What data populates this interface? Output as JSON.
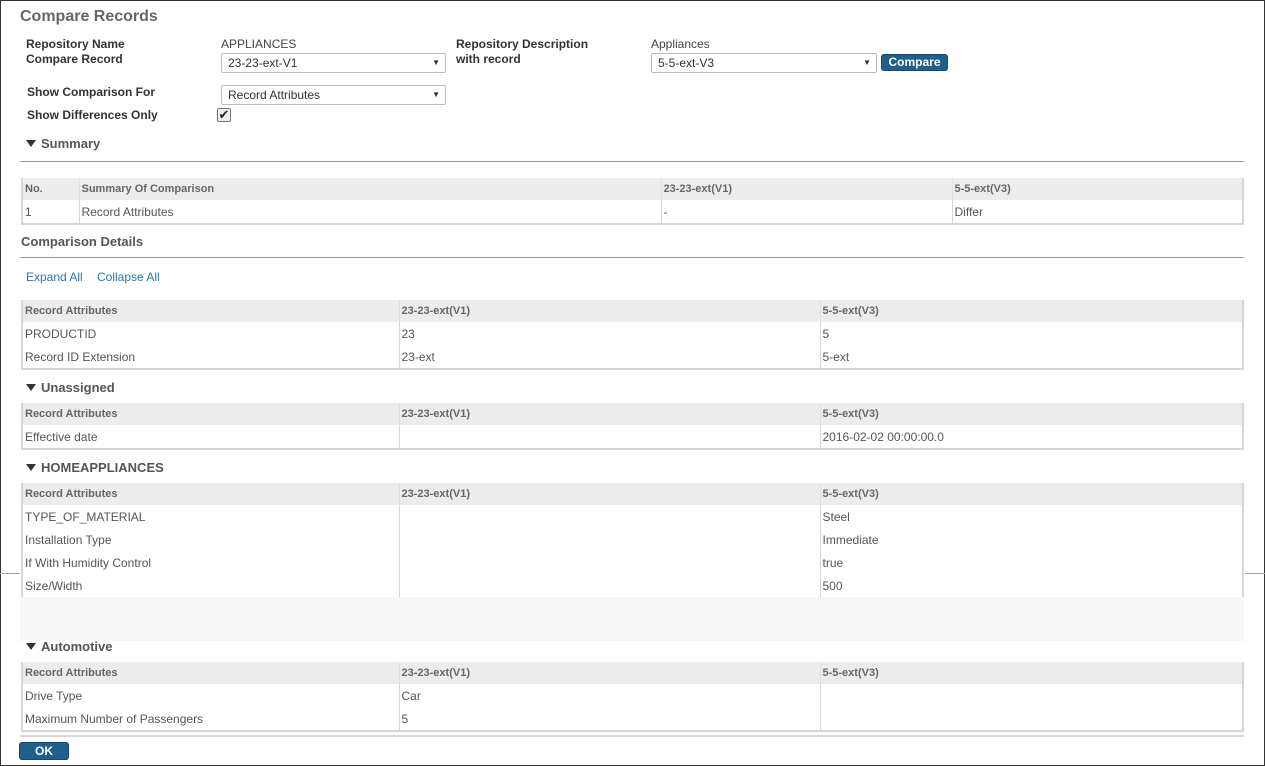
{
  "page": {
    "title": "Compare Records"
  },
  "form": {
    "repo_name_label": "Repository Name",
    "compare_record_label": "Compare Record",
    "repo_name_value": "APPLIANCES",
    "compare_record_value": "23-23-ext-V1",
    "repo_desc_label": "Repository Description",
    "with_record_label": "with record",
    "repo_desc_value": "Appliances",
    "with_record_value": "5-5-ext-V3",
    "compare_button": "Compare",
    "show_comparison_label": "Show Comparison For",
    "show_comparison_value": "Record Attributes",
    "diff_only_label": "Show Differences Only",
    "diff_only_checked": true
  },
  "summary": {
    "heading": "Summary",
    "columns": [
      "No.",
      "Summary Of Comparison",
      "23-23-ext(V1)",
      "5-5-ext(V3)"
    ],
    "rows": [
      [
        "1",
        "Record Attributes",
        "-",
        "Differ"
      ]
    ]
  },
  "details": {
    "heading": "Comparison Details",
    "expand_all": "Expand All",
    "collapse_all": "Collapse All",
    "columns": [
      "Record Attributes",
      "23-23-ext(V1)",
      "5-5-ext(V3)"
    ],
    "main_rows": [
      [
        "PRODUCTID",
        "23",
        "5"
      ],
      [
        "Record ID Extension",
        "23-ext",
        "5-ext"
      ]
    ],
    "groups": [
      {
        "name": "Unassigned",
        "rows": [
          [
            "Effective date",
            "",
            "2016-02-02 00:00:00.0"
          ]
        ]
      },
      {
        "name": "HOMEAPPLIANCES",
        "rows": [
          [
            "TYPE_OF_MATERIAL",
            "",
            "Steel"
          ],
          [
            "Installation Type",
            "",
            "Immediate"
          ],
          [
            "If With Humidity Control",
            "",
            "true"
          ],
          [
            "Size/Width",
            "",
            "500"
          ]
        ]
      },
      {
        "name": "Automotive",
        "rows": [
          [
            "Drive Type",
            "Car",
            ""
          ],
          [
            "Maximum Number of Passengers",
            "5",
            ""
          ]
        ]
      }
    ]
  },
  "footer": {
    "ok_button": "OK"
  },
  "colors": {
    "button_bg": "#1f5f8b",
    "link": "#2a76b3",
    "header_bg": "#ececec"
  }
}
